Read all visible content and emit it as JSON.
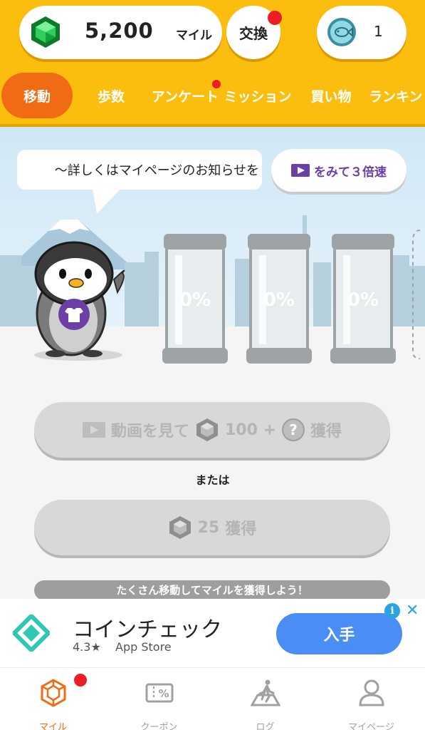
{
  "header": {
    "miles_value": "5,200",
    "miles_unit": "マイル",
    "exchange_label": "交換",
    "coin_count": "1"
  },
  "tabs": [
    {
      "label": "移動",
      "active": true
    },
    {
      "label": "歩数"
    },
    {
      "label": "アンケート",
      "badge": true
    },
    {
      "label": "ミッション"
    },
    {
      "label": "買い物"
    },
    {
      "label": "ランキン"
    }
  ],
  "scene": {
    "bubble_text": "〜詳しくはマイページのお知らせを",
    "video_button_label": "をみて３倍速",
    "jars": [
      "0%",
      "0%",
      "0%"
    ],
    "video_reward": {
      "prefix": "動画を見て",
      "amount": "100 +",
      "question": "?",
      "suffix": "獲得"
    },
    "or_text": "または",
    "simple_reward": {
      "amount": "25",
      "suffix": "獲得"
    },
    "hint": "たくさん移動してマイルを獲得しよう！"
  },
  "ad": {
    "title": "コインチェック",
    "rating": "4.3★",
    "store": "App Store",
    "button": "入手",
    "info": "i",
    "close": "✕"
  },
  "bottom_nav": [
    {
      "label": "マイル",
      "icon": "gem-outline-icon",
      "active": true,
      "badge": true
    },
    {
      "label": "クーポン",
      "icon": "coupon-icon"
    },
    {
      "label": "ログ",
      "icon": "walking-map-icon"
    },
    {
      "label": "マイページ",
      "icon": "person-icon"
    }
  ],
  "colors": {
    "header": "#fbbe0e",
    "active_tab": "#f06b13",
    "badge": "#ee1c24",
    "accent_purple": "#6a3fa6",
    "ad_button": "#4a8ef5"
  }
}
